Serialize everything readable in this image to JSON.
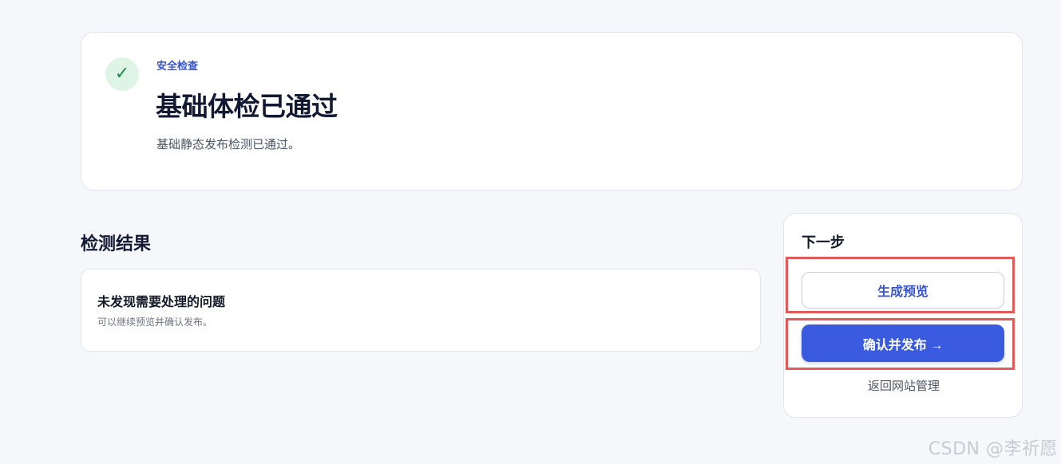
{
  "status": {
    "icon": "check-icon",
    "icon_glyph": "✓",
    "eyebrow": "安全检查",
    "title": "基础体检已通过",
    "description": "基础静态发布检测已通过。"
  },
  "results": {
    "heading": "检测结果",
    "item_title": "未发现需要处理的问题",
    "item_desc": "可以继续预览并确认发布。"
  },
  "next_steps": {
    "heading": "下一步",
    "preview_label": "生成预览",
    "publish_label": "确认并发布 →",
    "back_label": "返回网站管理"
  },
  "watermark": "CSDN @李祈愿",
  "colors": {
    "accent": "#3a5ae0",
    "success_bg": "#def5e6",
    "success_fg": "#1f8a4c",
    "highlight": "#e25a5a"
  }
}
